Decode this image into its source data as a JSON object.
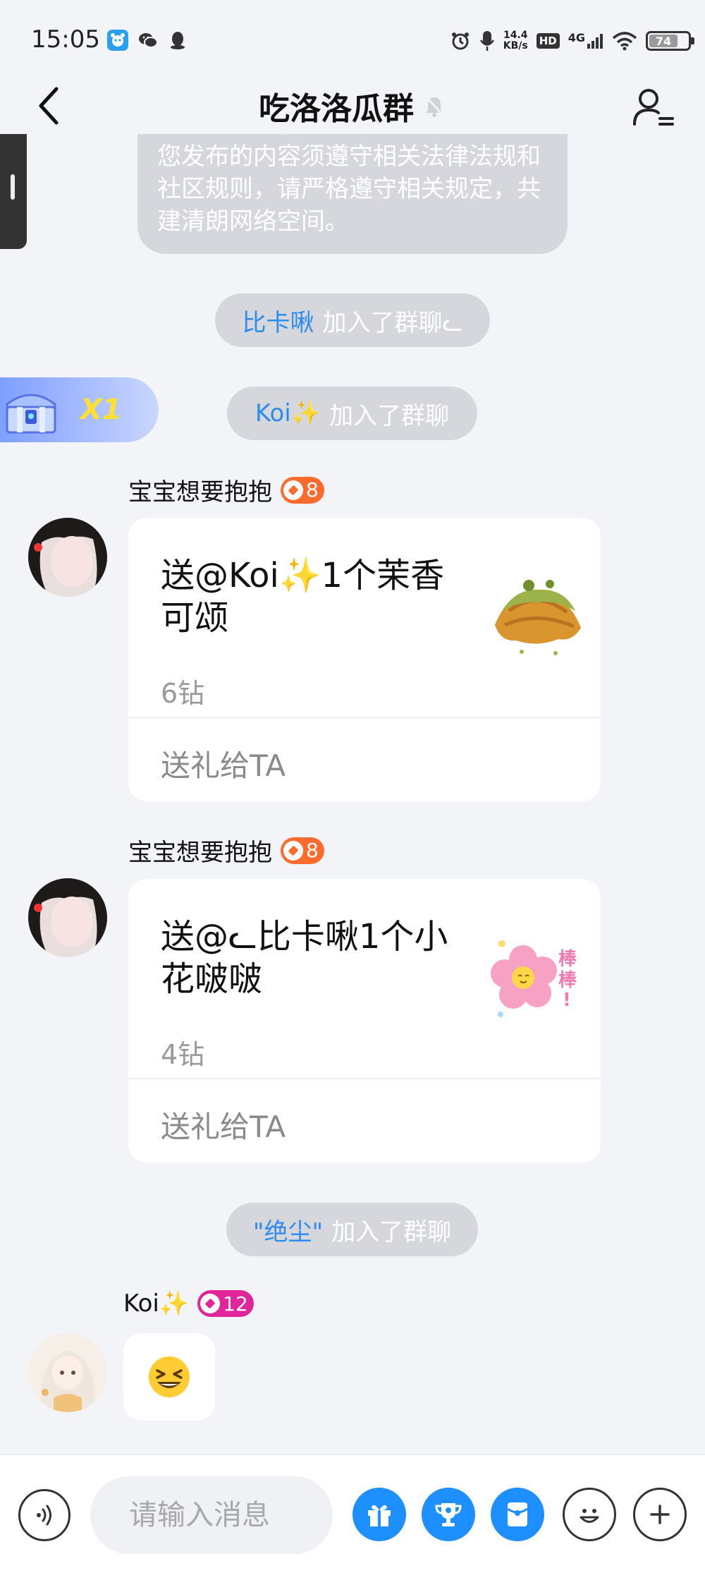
{
  "status_bar": {
    "time": "15:05",
    "net_speed_value": "14.4",
    "net_speed_unit": "KB/s",
    "hd_label": "HD",
    "network_label": "4G",
    "battery_level": "74"
  },
  "header": {
    "title": "吃洛洛瓜群"
  },
  "notice": {
    "text": "尊敬的用户，群组是网络公共空间。您发布的内容须遵守相关法律法规和社区规则，请严格遵守相关规定，共建清朗网络空间。"
  },
  "system_messages": [
    {
      "name": "比卡啾",
      "action": "加入了群聊ᓚ"
    },
    {
      "name": "Koi✨",
      "action": "加入了群聊"
    },
    {
      "name": "\"绝尘\"",
      "action": "加入了群聊"
    }
  ],
  "chest_badge": {
    "count": "X1"
  },
  "messages": [
    {
      "sender": "宝宝想要抱抱",
      "level": "8",
      "gift_title": "送@Koi✨1个茉香可颂",
      "gift_price": "6钻",
      "gift_action": "送礼给TA"
    },
    {
      "sender": "宝宝想要抱抱",
      "level": "8",
      "gift_title": "送@ᓚ比卡啾1个小花啵啵",
      "gift_price": "4钻",
      "gift_action": "送礼给TA"
    },
    {
      "sender": "Koi✨",
      "level": "12"
    }
  ],
  "gift_images": [
    "croissant-icon",
    "flower-icon"
  ],
  "input": {
    "placeholder": "请输入消息"
  },
  "colors": {
    "accent_blue": "#1e8fff",
    "name_blue": "#2d8bf0",
    "level_orange": "#ff6a2d",
    "level_pink": "#e0269a",
    "pill_gray": "#d5d7dc",
    "background": "#f2f4f8"
  }
}
